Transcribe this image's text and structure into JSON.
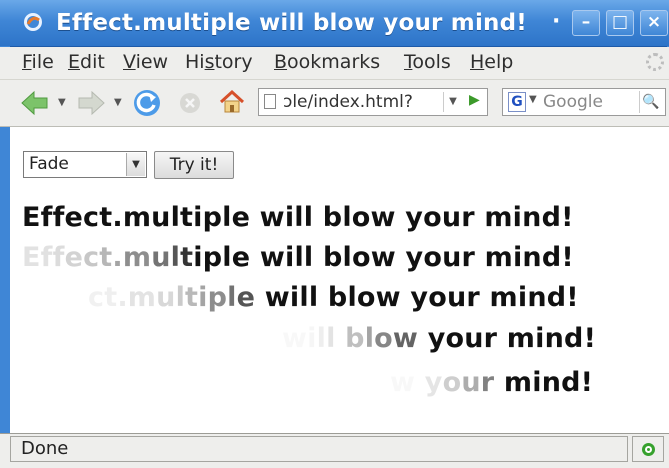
{
  "window": {
    "title": "Effect.multiple will blow your mind!",
    "title_dot": "·",
    "controls": {
      "minimize": "–",
      "maximize": "□",
      "close": "×"
    }
  },
  "menubar": {
    "items": [
      {
        "label_u": "F",
        "label_rest": "ile"
      },
      {
        "label_u": "E",
        "label_rest": "dit"
      },
      {
        "label_u": "V",
        "label_rest": "iew"
      },
      {
        "label_pre": "Hi",
        "label_u": "s",
        "label_rest": "tory"
      },
      {
        "label_u": "B",
        "label_rest": "ookmarks"
      },
      {
        "label_u": "T",
        "label_rest": "ools"
      },
      {
        "label_u": "H",
        "label_rest": "elp"
      }
    ]
  },
  "toolbar": {
    "address": "ɔle/index.html?",
    "search_engine_icon": "G",
    "search_placeholder": "Google"
  },
  "content": {
    "select_value": "Fade",
    "button_label": "Try it!",
    "effect_lines": [
      "Effect.multiple will blow your mind!",
      "Effect.multiple will blow your mind!",
      "ct.multiple will blow your mind!",
      "will blow your mind!",
      "w your mind!"
    ]
  },
  "statusbar": {
    "text": "Done",
    "icon": "secure-check-icon"
  },
  "colors": {
    "titlebar": "#3f86d6",
    "chrome": "#eeeeec",
    "status_ok": "#36a12d"
  }
}
